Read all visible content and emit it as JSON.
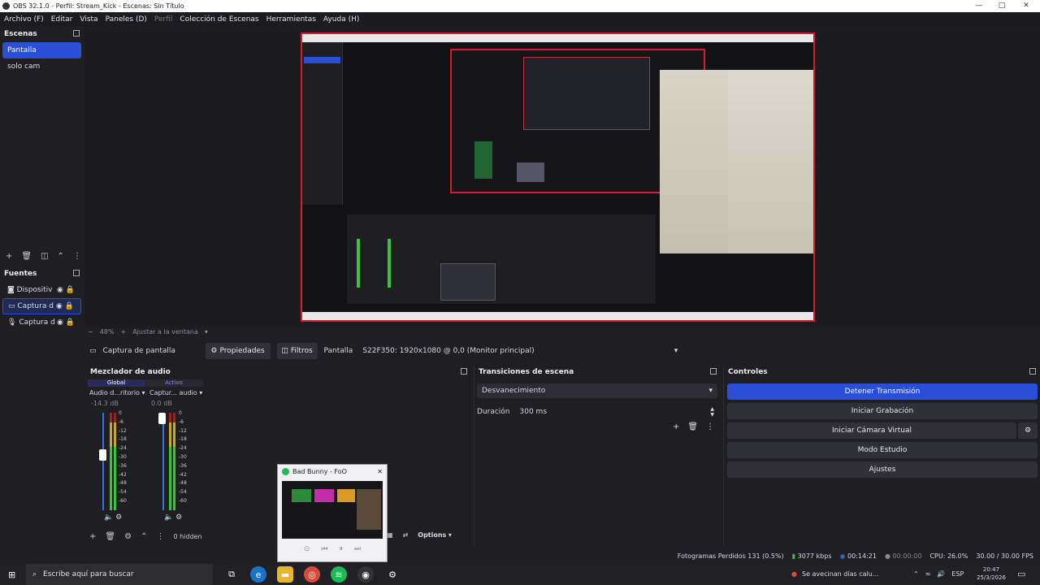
{
  "window": {
    "title": "OBS 32.1.0 - Perfil: Stream_Kick - Escenas: Sin Título",
    "minimize": "—",
    "maximize": "□",
    "close": "✕"
  },
  "menu": [
    "Archivo (F)",
    "Editar",
    "Vista",
    "Paneles (D)",
    "Perfil",
    "Colección de Escenas",
    "Herramientas",
    "Ayuda (H)"
  ],
  "scenes": {
    "title": "Escenas",
    "items": [
      "Pantalla",
      "solo cam"
    ],
    "selected": 0
  },
  "sources": {
    "title": "Fuentes",
    "items": [
      {
        "name": "Dispositiv",
        "icon": "camera-icon"
      },
      {
        "name": "Captura d",
        "icon": "monitor-icon"
      },
      {
        "name": "Captura d",
        "icon": "mic-icon"
      }
    ],
    "selected": 1
  },
  "preview": {
    "zoom": "48%",
    "fit_label": "Ajustar a la ventana"
  },
  "source_bar": {
    "source_name": "Captura de pantalla",
    "properties": "Propiedades",
    "filters": "Filtros",
    "display_label": "Pantalla",
    "display_value": "S22F350: 1920x1080 @ 0,0 (Monitor principal)"
  },
  "mixer": {
    "title": "Mezclador de audio",
    "tabs": [
      "Global",
      "Activo"
    ],
    "channels": [
      {
        "name": "Audio d...ritorio",
        "db": "-14.3 dB",
        "level": 0.62
      },
      {
        "name": "Captur... audio",
        "db": "0.0 dB",
        "level": 1.0
      }
    ],
    "scale": [
      "0",
      "-6",
      "-12",
      "-18",
      "-24",
      "-30",
      "-36",
      "-42",
      "-48",
      "-54",
      "-60"
    ],
    "hidden": "0 hidden",
    "options": "Options"
  },
  "transitions": {
    "title": "Transiciones de escena",
    "type": "Desvanecimiento",
    "duration_label": "Duración",
    "duration_value": "300 ms"
  },
  "controls": {
    "title": "Controles",
    "stop_stream": "Detener Transmisión",
    "start_recording": "Iniciar Grabación",
    "virtual_cam": "Iniciar Cámara Virtual",
    "studio_mode": "Modo Estudio",
    "settings": "Ajustes"
  },
  "popup": {
    "title": "Bad Bunny - FoO"
  },
  "status": {
    "dropped": "Fotogramas Perdidos 131 (0.5%)",
    "bitrate": "3077 kbps",
    "live_time": "00:14:21",
    "rec_time": "00:00:00",
    "cpu": "CPU: 26.0%",
    "fps": "30.00 / 30.00 FPS"
  },
  "taskbar": {
    "search_placeholder": "Escribe aquí para buscar",
    "weather": "Se avecinan días calu...",
    "lang": "ESP",
    "time": "20:47",
    "date": "25/3/2026"
  },
  "colors": {
    "accent": "#2a4fd6",
    "preview_border": "#d11f2f",
    "meter_green": "#3ac43a",
    "meter_yellow": "#c8a82a",
    "meter_red": "#a02020",
    "meter_blue": "#3a6fe0"
  }
}
